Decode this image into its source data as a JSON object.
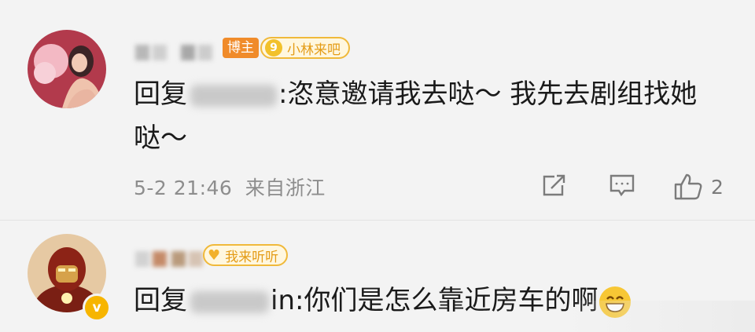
{
  "comments": [
    {
      "badge_host": "博主",
      "fan_level": "9",
      "fan_badge": "小林来吧",
      "reply_prefix": "回复",
      "reply_text": ":恣意邀请我去哒～ 我先去剧组找她",
      "reply_text_line2": "哒～",
      "time": "5-2 21:46",
      "location": "来自浙江",
      "like_count": "2",
      "icons": [
        "share-icon",
        "comment-icon",
        "like-icon"
      ]
    },
    {
      "fan_badge": "我来听听",
      "verified_badge": "v",
      "reply_prefix": "回复",
      "reply_text": "in:你们是怎么靠近房车的啊",
      "emoji": "grin-emoji",
      "icons": [
        "heart-badge-icon",
        "verified-icon"
      ]
    }
  ],
  "colors": {
    "badge_host": "#f08b2a",
    "fan_badge": "#f0b93a",
    "verified": "#f7b500",
    "meta_text": "#8d8d8d"
  }
}
